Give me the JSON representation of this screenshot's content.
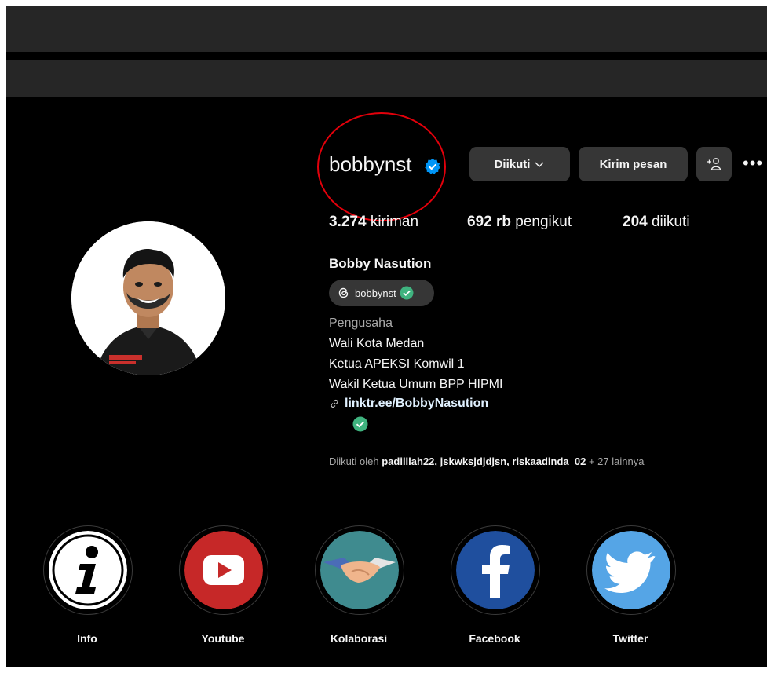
{
  "profile": {
    "username": "bobbynst",
    "buttons": {
      "follow": "Diikuti",
      "message": "Kirim pesan"
    },
    "stats": {
      "posts_count": "3.274",
      "posts_label": "kiriman",
      "followers_count": "692 rb",
      "followers_label": "pengikut",
      "following_count": "204",
      "following_label": "diikuti"
    },
    "full_name": "Bobby Nasution",
    "threads_handle": "bobbynst",
    "category": "Pengusaha",
    "bio": [
      "Wali Kota Medan",
      "Ketua APEKSI Komwil 1",
      "Wakil Ketua Umum BPP HIPMI"
    ],
    "link": "linktr.ee/BobbyNasution",
    "followed_by": {
      "prefix": "Diikuti oleh",
      "names": "padilllah22, jskwksjdjdjsn, riskaadinda_02",
      "suffix": "+ 27 lainnya"
    }
  },
  "highlights": [
    {
      "label": "Info",
      "icon": "info-icon"
    },
    {
      "label": "Youtube",
      "icon": "youtube-icon"
    },
    {
      "label": "Kolaborasi",
      "icon": "handshake-icon"
    },
    {
      "label": "Facebook",
      "icon": "facebook-icon"
    },
    {
      "label": "Twitter",
      "icon": "twitter-icon"
    }
  ],
  "colors": {
    "background": "#000000",
    "topbar": "#262626",
    "button": "#363636",
    "verified": "#0095f6",
    "annotation_circle": "#e3000b"
  }
}
